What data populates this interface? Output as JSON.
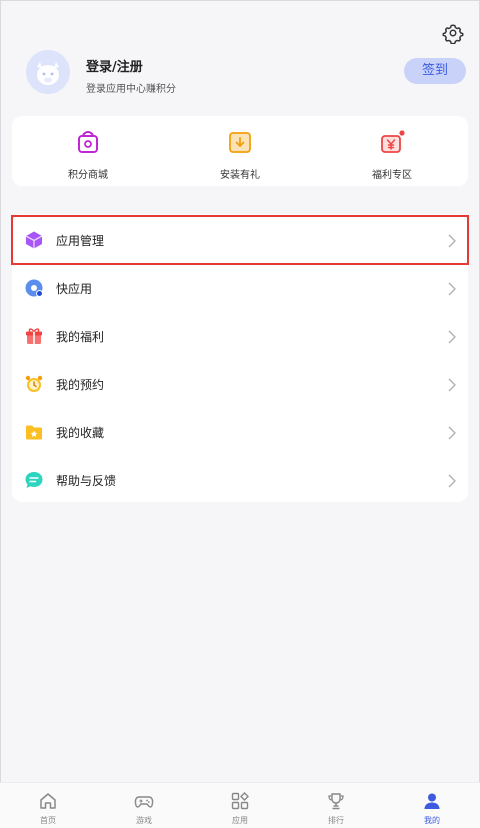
{
  "profile": {
    "title": "登录/注册",
    "subtitle": "登录应用中心赚积分",
    "signin_label": "签到"
  },
  "quick_actions": [
    {
      "label": "积分商城",
      "icon": "shopping-bag-icon"
    },
    {
      "label": "安装有礼",
      "icon": "gift-box-icon"
    },
    {
      "label": "福利专区",
      "icon": "yen-bag-icon"
    }
  ],
  "menu": [
    {
      "label": "应用管理",
      "icon": "cube-icon",
      "selected": true
    },
    {
      "label": "快应用",
      "icon": "quick-app-icon"
    },
    {
      "label": "我的福利",
      "icon": "gift-icon"
    },
    {
      "label": "我的预约",
      "icon": "alarm-clock-icon"
    },
    {
      "label": "我的收藏",
      "icon": "folder-star-icon"
    },
    {
      "label": "帮助与反馈",
      "icon": "chat-bubble-icon"
    }
  ],
  "tabs": [
    {
      "label": "首页",
      "icon": "home-icon"
    },
    {
      "label": "游戏",
      "icon": "gamepad-icon"
    },
    {
      "label": "应用",
      "icon": "apps-icon"
    },
    {
      "label": "排行",
      "icon": "trophy-icon"
    },
    {
      "label": "我的",
      "icon": "person-icon",
      "active": true
    }
  ],
  "colors": {
    "accent": "#3d5be0",
    "selection_outline": "#e53935",
    "background": "#f6f6f9"
  }
}
